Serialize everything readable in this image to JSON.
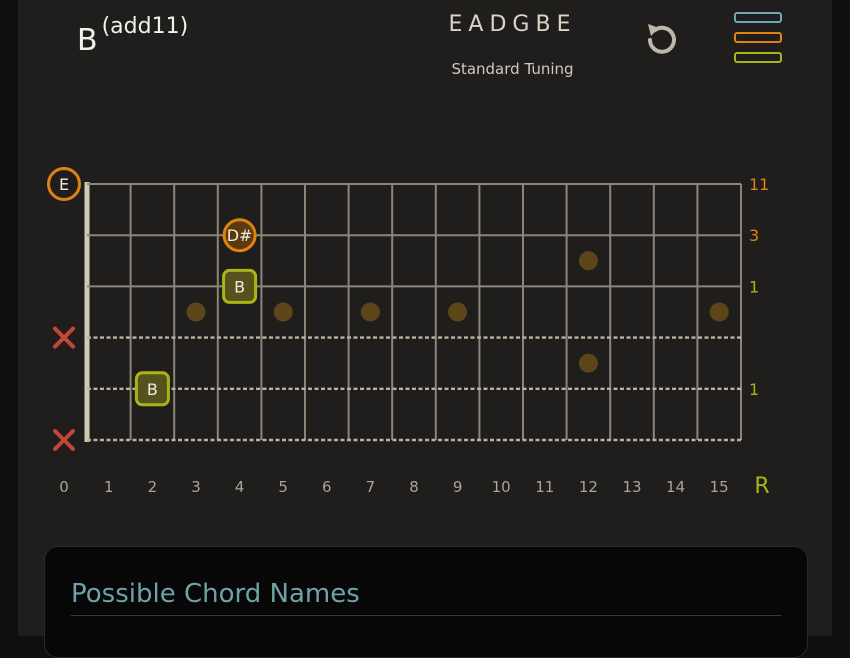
{
  "chord": {
    "root": "B",
    "suffix": "(add11)"
  },
  "tuning": {
    "notes": "EADGBE",
    "name": "Standard Tuning"
  },
  "icons": {
    "reset": "reset-icon",
    "menu": "menu-icon"
  },
  "colors": {
    "background": "#1f1e1c",
    "fret_line": "#8a8778",
    "nut": "#cfc9b6",
    "marker": "#5c4519",
    "orange": "#e0820f",
    "olive": "#a9b514",
    "muted_x": "#c2473a",
    "fret_number": "#a8a49a",
    "menu_blue": "#6aa8b8",
    "menu_orange": "#e0820f",
    "menu_green": "#a9b514"
  },
  "fretboard": {
    "fret_numbers": [
      "0",
      "1",
      "2",
      "3",
      "4",
      "5",
      "6",
      "7",
      "8",
      "9",
      "10",
      "11",
      "12",
      "13",
      "14",
      "15"
    ],
    "root_label": "R",
    "strings": [
      {
        "status": "open",
        "note": "E",
        "interval": "11",
        "interval_color": "orange",
        "dashed": false
      },
      {
        "status": "played",
        "fret": 4,
        "note": "D#",
        "interval": "3",
        "interval_color": "orange",
        "dashed": false
      },
      {
        "status": "played",
        "fret": 4,
        "note": "B",
        "interval": "1",
        "interval_color": "olive",
        "root": true,
        "dashed": false
      },
      {
        "status": "muted",
        "dashed": true
      },
      {
        "status": "played",
        "fret": 2,
        "note": "B",
        "interval": "1",
        "interval_color": "olive",
        "root": true,
        "dashed": true
      },
      {
        "status": "muted",
        "dashed": true
      }
    ],
    "markers": [
      3,
      5,
      7,
      9,
      12,
      15
    ]
  },
  "card": {
    "title": "Possible Chord Names"
  }
}
